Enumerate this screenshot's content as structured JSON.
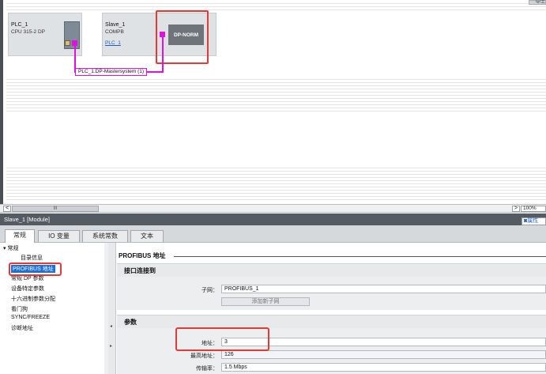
{
  "topbar": {
    "corner_label": "中土"
  },
  "network": {
    "plc": {
      "name": "PLC_1",
      "type": "CPU 315-2 DP"
    },
    "slave": {
      "name": "Slave_1",
      "type": "COMPB",
      "link": "PLC_1",
      "module": "DP-NORM"
    },
    "master_system": "PLC_1.DP-Mastersystem (1)"
  },
  "scrollbar": {
    "thumb_grip": "III",
    "left_arrow": "<",
    "right_arrow": ">",
    "zoom": "100%"
  },
  "inspector": {
    "title": "Slave_1 [Module]",
    "properties_tab": "属性",
    "tabs": [
      "常规",
      "IO 变量",
      "系统常数",
      "文本"
    ]
  },
  "tree": {
    "items": [
      "常规",
      "目录信息",
      "PROFIBUS 地址",
      "常规 DP 参数",
      "设备特定参数",
      "十六进制参数分配",
      "看门狗",
      "SYNC/FREEZE",
      "诊断地址"
    ],
    "selected_index": 2
  },
  "content": {
    "section_title": "PROFIBUS 地址",
    "interface_panel": {
      "title": "接口连接到",
      "subnet_label": "子网：",
      "subnet_value": "PROFIBUS_1",
      "add_subnet_button": "添加新子网"
    },
    "params_panel": {
      "title": "参数",
      "address_label": "地址：",
      "address_value": "3",
      "max_address_label": "最高地址：",
      "max_address_value": "126",
      "baud_label": "传输率：",
      "baud_value": "1.5 Mbps"
    }
  },
  "colors": {
    "profibus_line": "#e010e0",
    "highlight": "#e53935",
    "selected": "#1e6fd9"
  }
}
